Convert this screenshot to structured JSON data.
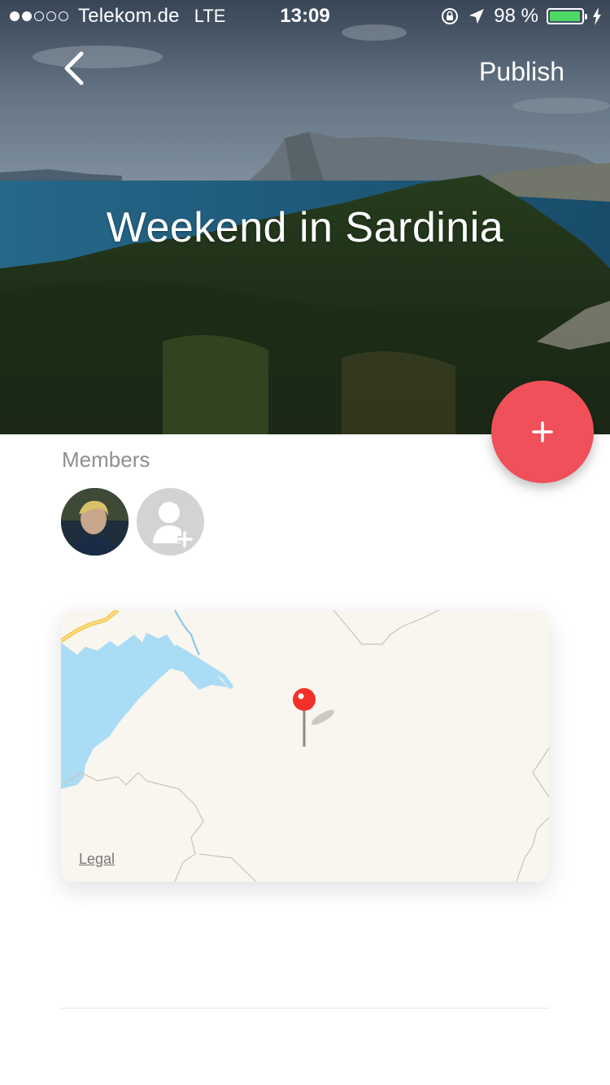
{
  "status_bar": {
    "carrier": "Telekom.de",
    "network": "LTE",
    "time": "13:09",
    "battery_text": "98 %",
    "battery_level": 0.98,
    "signal_bars_filled": 2,
    "signal_bars_total": 5
  },
  "nav": {
    "back_icon": "chevron-left-icon",
    "publish_label": "Publish"
  },
  "trip": {
    "title": "Weekend in Sardinia"
  },
  "fab": {
    "icon": "plus-icon"
  },
  "members": {
    "label": "Members",
    "add_icon": "add-person-icon"
  },
  "map": {
    "legal_label": "Legal",
    "pin_icon": "map-pin-icon"
  },
  "colors": {
    "accent": "#f05059",
    "battery": "#4cd964",
    "map_water": "#aadcf5",
    "map_land": "#f9f5ef",
    "pin": "#f4302b"
  }
}
